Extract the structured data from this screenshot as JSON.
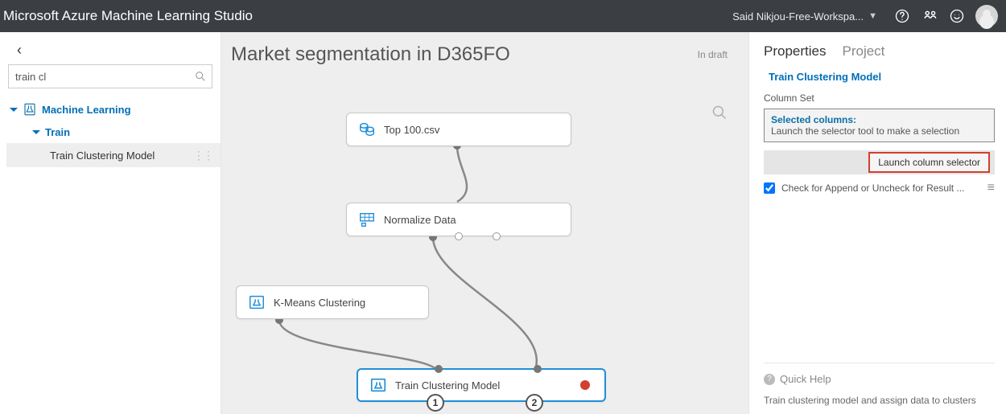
{
  "header": {
    "app_title": "Microsoft Azure Machine Learning Studio",
    "workspace_label": "Said Nikjou-Free-Workspa..."
  },
  "sidebar": {
    "search_value": "train cl",
    "root_label": "Machine Learning",
    "child_label": "Train",
    "leaf_label": "Train Clustering Model"
  },
  "canvas": {
    "experiment_title": "Market segmentation in D365FO",
    "status": "In draft",
    "nodes": {
      "top100": "Top 100.csv",
      "normalize": "Normalize Data",
      "kmeans": "K-Means Clustering",
      "traincluster": "Train Clustering Model"
    },
    "port_badges": {
      "one": "1",
      "two": "2"
    }
  },
  "properties": {
    "tabs": {
      "properties": "Properties",
      "project": "Project"
    },
    "section_title": "Train Clustering Model",
    "column_set_label": "Column Set",
    "selected_columns_label": "Selected columns:",
    "selected_columns_msg": "Launch the selector tool to make a selection",
    "launch_button": "Launch column selector",
    "check_label": "Check for Append or Uncheck for Result ...",
    "quick_help_title": "Quick Help",
    "quick_help_body": "Train clustering model and assign data to clusters"
  }
}
